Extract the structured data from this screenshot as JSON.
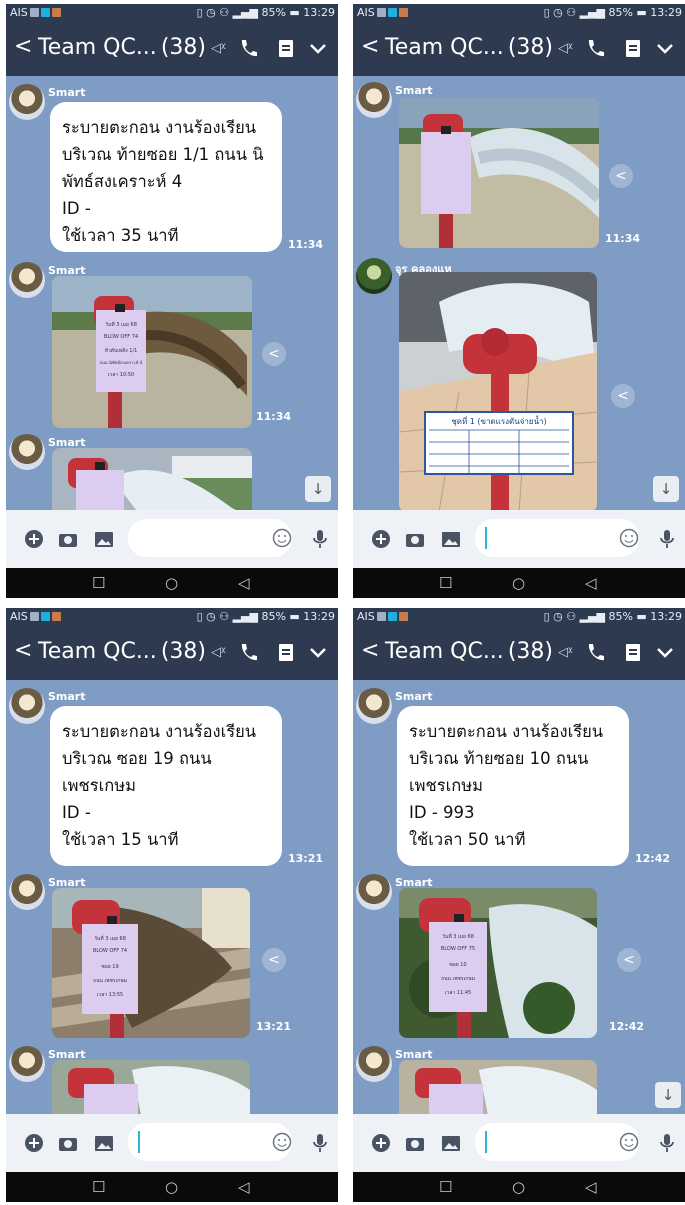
{
  "status_bar": {
    "carrier": "AIS",
    "battery": "85%",
    "time": "13:29"
  },
  "header": {
    "title": "Team QC...",
    "member_count": "(38)"
  },
  "panels": [
    {
      "first_sender": "Smart",
      "message": "ระบายตะกอน งานร้องเรียน\nบริเวณ ท้ายซอย 1/1 ถนน นิพัทธ์สงเคราะห์ 4\nID -\nใช้เวลา 35 นาที",
      "message_time": "11:34",
      "second_sender": "Smart",
      "photo_time": "11:34",
      "third_sender": "Smart",
      "sign": {
        "date": "วันที่ 3 เมย 68",
        "blow": "BLOW OFF 74",
        "loc": "หัวดับเพลิง 1/1",
        "road": "ถนน นิพัทธ์สงเคราะห์ 4",
        "time_note": "เวลา 10:50"
      }
    },
    {
      "first_sender": "Smart",
      "photo_time": "11:34",
      "second_sender": "จุร คลองแห",
      "board_title": "ชุดที่ 1 (ขาดแรงดันจ่ายน้ำ)"
    },
    {
      "first_sender": "Smart",
      "message": "ระบายตะกอน งานร้องเรียน\nบริเวณ ซอย 19 ถนน\nเพชรเกษม\nID -\nใช้เวลา 15 นาที",
      "message_time": "13:21",
      "second_sender": "Smart",
      "photo_time": "13:21",
      "third_sender": "Smart",
      "sign": {
        "date": "วันที่ 3 เมย 68",
        "blow": "BLOW OFF 74",
        "loc": "ซอย 19",
        "road": "ถนน เพชรเกษม",
        "time_note": "เวลา 13:55"
      }
    },
    {
      "first_sender": "Smart",
      "message": "ระบายตะกอน งานร้องเรียน\nบริเวณ ท้ายซอย 10 ถนน\nเพชรเกษม\nID - 993\nใช้เวลา 50 นาที",
      "message_time": "12:42",
      "second_sender": "Smart",
      "photo_time": "12:42",
      "third_sender": "Smart",
      "sign": {
        "date": "วันที่ 3 เมย 68",
        "blow": "BLOW OFF 75",
        "loc": "ซอย 10",
        "road": "ถนน เพชรเกษม",
        "time_note": "เวลา 11:45"
      }
    }
  ],
  "colors": {
    "chat_bg": "#7f9cc5",
    "header_bg": "#2e3a4f",
    "status_bg": "#2d3b51",
    "cursor": "#27b8d6",
    "sign_paper": "#dcccf0",
    "hydrant_red": "#c4333a"
  }
}
